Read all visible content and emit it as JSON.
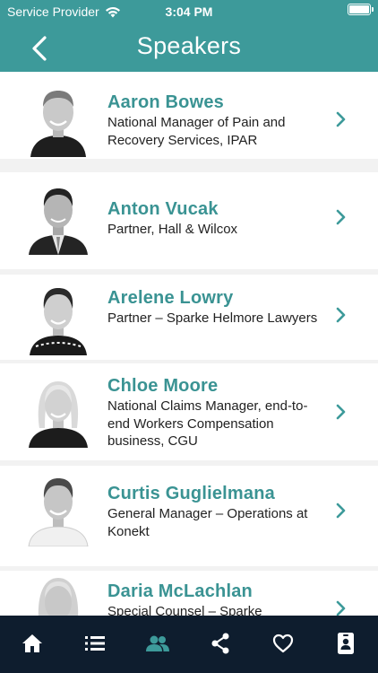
{
  "status": {
    "carrier": "Service Provider",
    "time": "3:04 PM"
  },
  "header": {
    "title": "Speakers"
  },
  "speakers": [
    {
      "name": "Aaron Bowes",
      "role": "National Manager of Pain and Recovery Services, IPAR"
    },
    {
      "name": "Anton Vucak",
      "role": "Partner, Hall & Wilcox"
    },
    {
      "name": "Arelene Lowry",
      "role": "Partner – Sparke Helmore Lawyers"
    },
    {
      "name": "Chloe Moore",
      "role": "National Claims Manager, end-to-end Workers Compensation business, CGU"
    },
    {
      "name": "Curtis Guglielmana",
      "role": "General Manager – Operations at Konekt"
    },
    {
      "name": "Daria McLachlan",
      "role": "Special Counsel – Sparke"
    }
  ],
  "tabs": [
    {
      "icon": "home-icon"
    },
    {
      "icon": "list-icon"
    },
    {
      "icon": "people-icon",
      "active": true
    },
    {
      "icon": "share-icon"
    },
    {
      "icon": "heart-icon"
    },
    {
      "icon": "id-badge-icon"
    }
  ],
  "colors": {
    "header": "#3d9a9a",
    "name": "#3a9393",
    "tabbar": "#0e1d2e",
    "tab_active": "#3d9a9a"
  }
}
